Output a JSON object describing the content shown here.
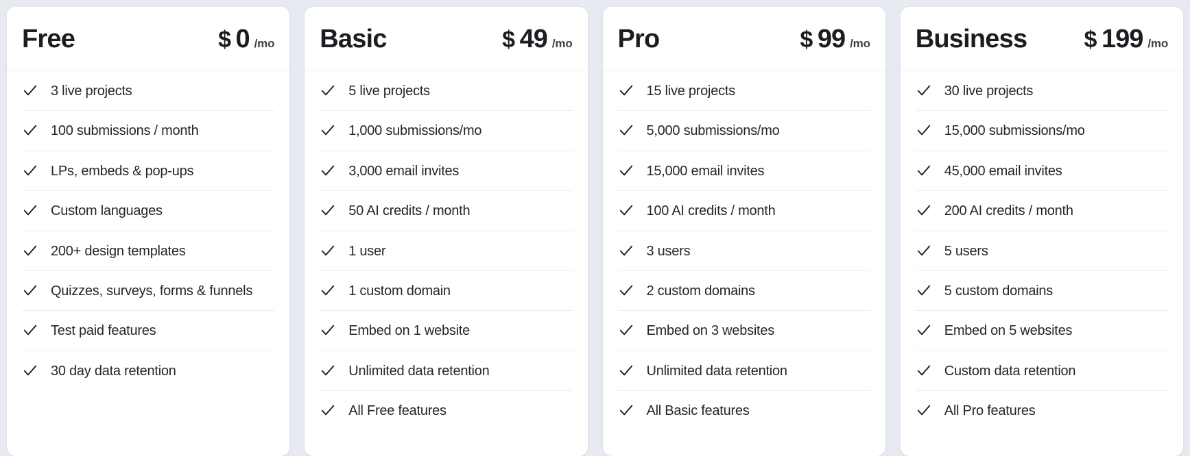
{
  "theme": {
    "page_background": "#e7eaf0",
    "card_background": "#ffffff",
    "text_color": "#24262b",
    "heading_color": "#1b1d21",
    "divider_color": "#ededf0"
  },
  "icons": {
    "check": "check-icon"
  },
  "plans": [
    {
      "name": "Free",
      "currency": "$",
      "amount": "0",
      "period": "/mo",
      "features": [
        "3 live projects",
        "100 submissions / month",
        "LPs, embeds & pop-ups",
        "Custom languages",
        "200+ design templates",
        "Quizzes, surveys, forms & funnels",
        "Test paid features",
        "30 day data retention"
      ]
    },
    {
      "name": "Basic",
      "currency": "$",
      "amount": "49",
      "period": "/mo",
      "features": [
        "5 live projects",
        "1,000 submissions/mo",
        "3,000 email invites",
        "50 AI credits / month",
        "1 user",
        "1 custom domain",
        "Embed on 1 website",
        "Unlimited data retention",
        "All Free features"
      ]
    },
    {
      "name": "Pro",
      "currency": "$",
      "amount": "99",
      "period": "/mo",
      "features": [
        "15 live projects",
        "5,000 submissions/mo",
        "15,000 email invites",
        "100 AI credits / month",
        "3 users",
        "2 custom domains",
        "Embed on 3 websites",
        "Unlimited data retention",
        "All Basic features"
      ]
    },
    {
      "name": "Business",
      "currency": "$",
      "amount": "199",
      "period": "/mo",
      "features": [
        "30 live projects",
        "15,000 submissions/mo",
        "45,000 email invites",
        "200 AI credits / month",
        "5 users",
        "5 custom domains",
        "Embed on 5 websites",
        "Custom data retention",
        "All Pro features"
      ]
    }
  ]
}
